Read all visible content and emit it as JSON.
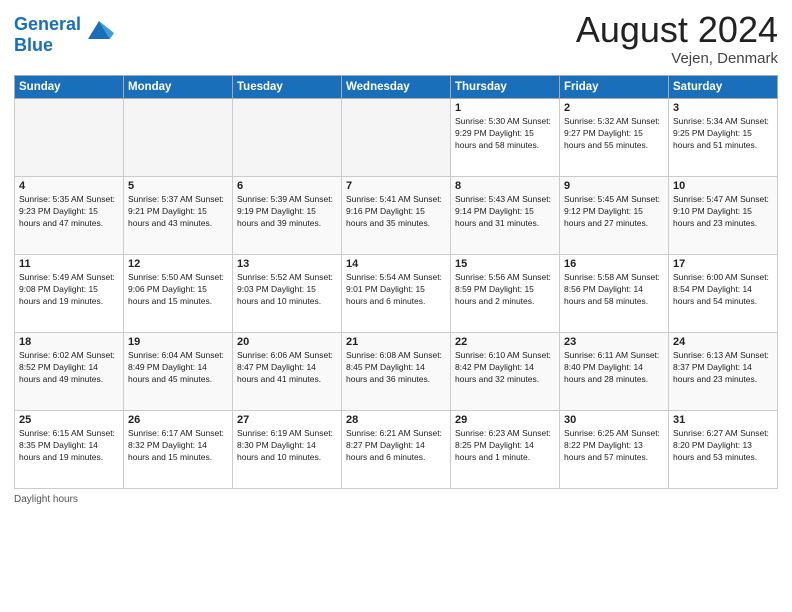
{
  "header": {
    "logo_line1": "General",
    "logo_line2": "Blue",
    "month_year": "August 2024",
    "location": "Vejen, Denmark"
  },
  "weekdays": [
    "Sunday",
    "Monday",
    "Tuesday",
    "Wednesday",
    "Thursday",
    "Friday",
    "Saturday"
  ],
  "footer": {
    "daylight_label": "Daylight hours"
  },
  "weeks": [
    [
      {
        "day": "",
        "info": ""
      },
      {
        "day": "",
        "info": ""
      },
      {
        "day": "",
        "info": ""
      },
      {
        "day": "",
        "info": ""
      },
      {
        "day": "1",
        "info": "Sunrise: 5:30 AM\nSunset: 9:29 PM\nDaylight: 15 hours\nand 58 minutes."
      },
      {
        "day": "2",
        "info": "Sunrise: 5:32 AM\nSunset: 9:27 PM\nDaylight: 15 hours\nand 55 minutes."
      },
      {
        "day": "3",
        "info": "Sunrise: 5:34 AM\nSunset: 9:25 PM\nDaylight: 15 hours\nand 51 minutes."
      }
    ],
    [
      {
        "day": "4",
        "info": "Sunrise: 5:35 AM\nSunset: 9:23 PM\nDaylight: 15 hours\nand 47 minutes."
      },
      {
        "day": "5",
        "info": "Sunrise: 5:37 AM\nSunset: 9:21 PM\nDaylight: 15 hours\nand 43 minutes."
      },
      {
        "day": "6",
        "info": "Sunrise: 5:39 AM\nSunset: 9:19 PM\nDaylight: 15 hours\nand 39 minutes."
      },
      {
        "day": "7",
        "info": "Sunrise: 5:41 AM\nSunset: 9:16 PM\nDaylight: 15 hours\nand 35 minutes."
      },
      {
        "day": "8",
        "info": "Sunrise: 5:43 AM\nSunset: 9:14 PM\nDaylight: 15 hours\nand 31 minutes."
      },
      {
        "day": "9",
        "info": "Sunrise: 5:45 AM\nSunset: 9:12 PM\nDaylight: 15 hours\nand 27 minutes."
      },
      {
        "day": "10",
        "info": "Sunrise: 5:47 AM\nSunset: 9:10 PM\nDaylight: 15 hours\nand 23 minutes."
      }
    ],
    [
      {
        "day": "11",
        "info": "Sunrise: 5:49 AM\nSunset: 9:08 PM\nDaylight: 15 hours\nand 19 minutes."
      },
      {
        "day": "12",
        "info": "Sunrise: 5:50 AM\nSunset: 9:06 PM\nDaylight: 15 hours\nand 15 minutes."
      },
      {
        "day": "13",
        "info": "Sunrise: 5:52 AM\nSunset: 9:03 PM\nDaylight: 15 hours\nand 10 minutes."
      },
      {
        "day": "14",
        "info": "Sunrise: 5:54 AM\nSunset: 9:01 PM\nDaylight: 15 hours\nand 6 minutes."
      },
      {
        "day": "15",
        "info": "Sunrise: 5:56 AM\nSunset: 8:59 PM\nDaylight: 15 hours\nand 2 minutes."
      },
      {
        "day": "16",
        "info": "Sunrise: 5:58 AM\nSunset: 8:56 PM\nDaylight: 14 hours\nand 58 minutes."
      },
      {
        "day": "17",
        "info": "Sunrise: 6:00 AM\nSunset: 8:54 PM\nDaylight: 14 hours\nand 54 minutes."
      }
    ],
    [
      {
        "day": "18",
        "info": "Sunrise: 6:02 AM\nSunset: 8:52 PM\nDaylight: 14 hours\nand 49 minutes."
      },
      {
        "day": "19",
        "info": "Sunrise: 6:04 AM\nSunset: 8:49 PM\nDaylight: 14 hours\nand 45 minutes."
      },
      {
        "day": "20",
        "info": "Sunrise: 6:06 AM\nSunset: 8:47 PM\nDaylight: 14 hours\nand 41 minutes."
      },
      {
        "day": "21",
        "info": "Sunrise: 6:08 AM\nSunset: 8:45 PM\nDaylight: 14 hours\nand 36 minutes."
      },
      {
        "day": "22",
        "info": "Sunrise: 6:10 AM\nSunset: 8:42 PM\nDaylight: 14 hours\nand 32 minutes."
      },
      {
        "day": "23",
        "info": "Sunrise: 6:11 AM\nSunset: 8:40 PM\nDaylight: 14 hours\nand 28 minutes."
      },
      {
        "day": "24",
        "info": "Sunrise: 6:13 AM\nSunset: 8:37 PM\nDaylight: 14 hours\nand 23 minutes."
      }
    ],
    [
      {
        "day": "25",
        "info": "Sunrise: 6:15 AM\nSunset: 8:35 PM\nDaylight: 14 hours\nand 19 minutes."
      },
      {
        "day": "26",
        "info": "Sunrise: 6:17 AM\nSunset: 8:32 PM\nDaylight: 14 hours\nand 15 minutes."
      },
      {
        "day": "27",
        "info": "Sunrise: 6:19 AM\nSunset: 8:30 PM\nDaylight: 14 hours\nand 10 minutes."
      },
      {
        "day": "28",
        "info": "Sunrise: 6:21 AM\nSunset: 8:27 PM\nDaylight: 14 hours\nand 6 minutes."
      },
      {
        "day": "29",
        "info": "Sunrise: 6:23 AM\nSunset: 8:25 PM\nDaylight: 14 hours\nand 1 minute."
      },
      {
        "day": "30",
        "info": "Sunrise: 6:25 AM\nSunset: 8:22 PM\nDaylight: 13 hours\nand 57 minutes."
      },
      {
        "day": "31",
        "info": "Sunrise: 6:27 AM\nSunset: 8:20 PM\nDaylight: 13 hours\nand 53 minutes."
      }
    ]
  ]
}
